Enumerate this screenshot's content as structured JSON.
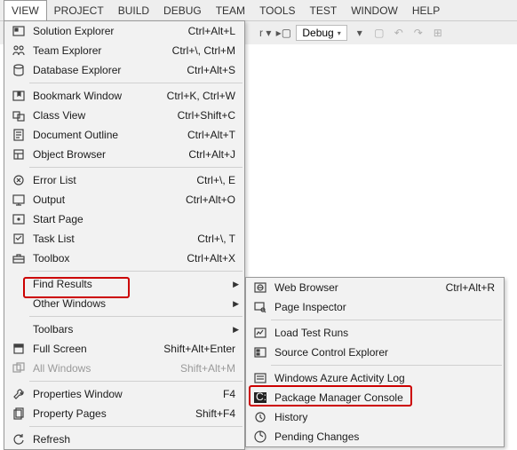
{
  "menubar": [
    "VIEW",
    "PROJECT",
    "BUILD",
    "DEBUG",
    "TEAM",
    "TOOLS",
    "TEST",
    "WINDOW",
    "HELP"
  ],
  "toolbar": {
    "config": "Debug"
  },
  "view_menu": [
    {
      "icon": "solution",
      "label": "Solution Explorer",
      "shortcut": "Ctrl+Alt+L"
    },
    {
      "icon": "team",
      "label": "Team Explorer",
      "shortcut": "Ctrl+\\, Ctrl+M"
    },
    {
      "icon": "db",
      "label": "Database Explorer",
      "shortcut": "Ctrl+Alt+S"
    },
    {
      "sep": true
    },
    {
      "icon": "bookmark",
      "label": "Bookmark Window",
      "shortcut": "Ctrl+K, Ctrl+W"
    },
    {
      "icon": "class",
      "label": "Class View",
      "shortcut": "Ctrl+Shift+C"
    },
    {
      "icon": "docoutline",
      "label": "Document Outline",
      "shortcut": "Ctrl+Alt+T"
    },
    {
      "icon": "objbrowser",
      "label": "Object Browser",
      "shortcut": "Ctrl+Alt+J"
    },
    {
      "sep": true
    },
    {
      "icon": "error",
      "label": "Error List",
      "shortcut": "Ctrl+\\, E"
    },
    {
      "icon": "output",
      "label": "Output",
      "shortcut": "Ctrl+Alt+O"
    },
    {
      "icon": "start",
      "label": "Start Page",
      "shortcut": ""
    },
    {
      "icon": "task",
      "label": "Task List",
      "shortcut": "Ctrl+\\, T"
    },
    {
      "icon": "toolbox",
      "label": "Toolbox",
      "shortcut": "Ctrl+Alt+X"
    },
    {
      "sep": true
    },
    {
      "icon": "",
      "label": "Find Results",
      "shortcut": "",
      "sub": true
    },
    {
      "icon": "",
      "label": "Other Windows",
      "shortcut": "",
      "sub": true
    },
    {
      "sep": true
    },
    {
      "icon": "",
      "label": "Toolbars",
      "shortcut": "",
      "sub": true
    },
    {
      "icon": "fullscreen",
      "label": "Full Screen",
      "shortcut": "Shift+Alt+Enter"
    },
    {
      "icon": "allwin",
      "label": "All Windows",
      "shortcut": "Shift+Alt+M",
      "disabled": true
    },
    {
      "sep": true
    },
    {
      "icon": "wrench",
      "label": "Properties Window",
      "shortcut": "F4"
    },
    {
      "icon": "pages",
      "label": "Property Pages",
      "shortcut": "Shift+F4"
    },
    {
      "sep": true
    },
    {
      "icon": "refresh",
      "label": "Refresh",
      "shortcut": ""
    }
  ],
  "other_windows": [
    {
      "icon": "web",
      "label": "Web Browser",
      "shortcut": "Ctrl+Alt+R"
    },
    {
      "icon": "inspector",
      "label": "Page Inspector",
      "shortcut": ""
    },
    {
      "sep": true
    },
    {
      "icon": "loadtest",
      "label": "Load Test Runs",
      "shortcut": ""
    },
    {
      "icon": "sourcectrl",
      "label": "Source Control Explorer",
      "shortcut": ""
    },
    {
      "sep": true
    },
    {
      "icon": "azure",
      "label": "Windows Azure Activity Log",
      "shortcut": ""
    },
    {
      "icon": "pmc",
      "label": "Package Manager Console",
      "shortcut": ""
    },
    {
      "icon": "history",
      "label": "History",
      "shortcut": ""
    },
    {
      "icon": "pending",
      "label": "Pending Changes",
      "shortcut": ""
    }
  ]
}
